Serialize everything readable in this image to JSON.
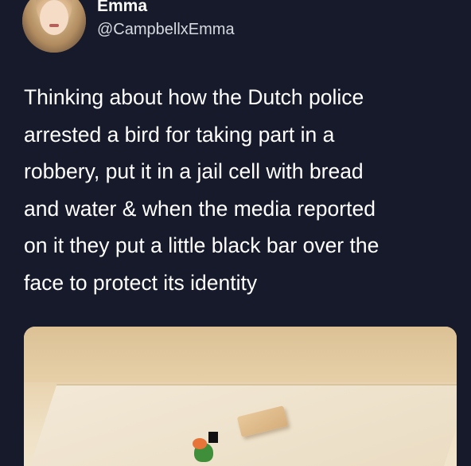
{
  "tweet": {
    "author": {
      "name": "Emma",
      "handle": "@CampbellxEmma"
    },
    "text_lines": [
      "Thinking about how the Dutch police",
      "arrested a bird for taking part in a",
      "robbery, put it in a jail cell with bread",
      "and water & when the media reported",
      "on it they put a little black bar over the",
      "face to protect its identity"
    ]
  },
  "colors": {
    "background": "#161a2b",
    "text": "#ffffff",
    "handle": "#d6d9de"
  }
}
